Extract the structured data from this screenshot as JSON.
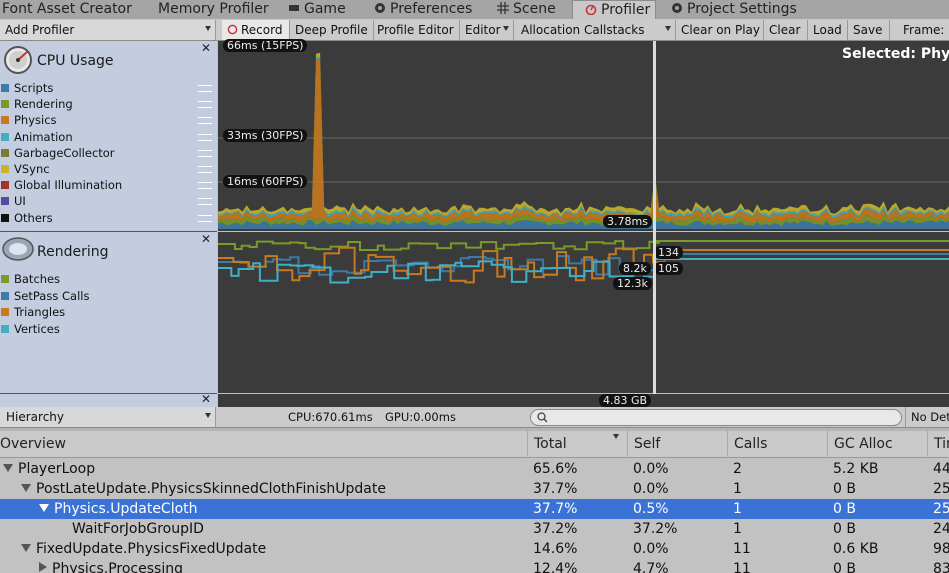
{
  "tabs": [
    {
      "label": "Font Asset Creator",
      "icon": ""
    },
    {
      "label": "Memory Profiler",
      "icon": ""
    },
    {
      "label": "Game",
      "icon": "game-icon"
    },
    {
      "label": "Preferences",
      "icon": "gear-icon"
    },
    {
      "label": "Scene",
      "icon": "grid-icon"
    },
    {
      "label": "Profiler",
      "icon": "profiler-icon"
    },
    {
      "label": "Project Settings",
      "icon": "gear-icon"
    }
  ],
  "toolbar": {
    "add_profiler": "Add Profiler",
    "record": "Record",
    "deep_profile": "Deep Profile",
    "profile_editor": "Profile Editor",
    "editor": "Editor",
    "allocation_callstacks": "Allocation Callstacks",
    "clear_on_play": "Clear on Play",
    "clear": "Clear",
    "load": "Load",
    "save": "Save",
    "frame": "Frame:"
  },
  "cpu": {
    "title": "CPU Usage",
    "legend": [
      {
        "label": "Scripts",
        "color": "#3d7aa6"
      },
      {
        "label": "Rendering",
        "color": "#7b9a2a"
      },
      {
        "label": "Physics",
        "color": "#c77a1e"
      },
      {
        "label": "Animation",
        "color": "#3fb0c8"
      },
      {
        "label": "GarbageCollector",
        "color": "#7a7a3a"
      },
      {
        "label": "VSync",
        "color": "#c9b52b"
      },
      {
        "label": "Global Illumination",
        "color": "#a0332b"
      },
      {
        "label": "UI",
        "color": "#5a4a9a"
      },
      {
        "label": "Others",
        "color": "#111111"
      }
    ],
    "labels": {
      "l66": "66ms (15FPS)",
      "l33": "33ms (30FPS)",
      "l16": "16ms (60FPS)",
      "current": "3.78ms"
    },
    "selected": "Selected: Phys"
  },
  "rendering": {
    "title": "Rendering",
    "legend": [
      {
        "label": "Batches",
        "color": "#7b9a2a"
      },
      {
        "label": "SetPass Calls",
        "color": "#3d7aa6"
      },
      {
        "label": "Triangles",
        "color": "#c77a1e"
      },
      {
        "label": "Vertices",
        "color": "#3fb0c8"
      }
    ],
    "values": {
      "batches": "134",
      "setpass": "105",
      "triangles": "8.2k",
      "vertices": "12.3k"
    }
  },
  "memory": {
    "value": "4.83 GB"
  },
  "hierarchy": {
    "mode": "Hierarchy",
    "cpu": "CPU:670.61ms",
    "gpu": "GPU:0.00ms",
    "search_placeholder": "",
    "no_details": "No Det"
  },
  "table": {
    "headers": [
      "Overview",
      "Total",
      "Self",
      "Calls",
      "GC Alloc",
      "Tim"
    ],
    "rows": [
      {
        "name": "PlayerLoop",
        "total": "65.6%",
        "self": "0.0%",
        "calls": "2",
        "gc": "5.2 KB",
        "time": "44",
        "indent": 0,
        "expand": "down",
        "selected": false
      },
      {
        "name": "PostLateUpdate.PhysicsSkinnedClothFinishUpdate",
        "total": "37.7%",
        "self": "0.0%",
        "calls": "1",
        "gc": "0 B",
        "time": "25",
        "indent": 1,
        "expand": "down",
        "selected": false
      },
      {
        "name": "Physics.UpdateCloth",
        "total": "37.7%",
        "self": "0.5%",
        "calls": "1",
        "gc": "0 B",
        "time": "25",
        "indent": 2,
        "expand": "down",
        "selected": true
      },
      {
        "name": "WaitForJobGroupID",
        "total": "37.2%",
        "self": "37.2%",
        "calls": "1",
        "gc": "0 B",
        "time": "24",
        "indent": 3,
        "expand": "none",
        "selected": false
      },
      {
        "name": "FixedUpdate.PhysicsFixedUpdate",
        "total": "14.6%",
        "self": "0.0%",
        "calls": "11",
        "gc": "0.6 KB",
        "time": "98",
        "indent": 1,
        "expand": "down",
        "selected": false
      },
      {
        "name": "Physics.Processing",
        "total": "12.4%",
        "self": "4.7%",
        "calls": "11",
        "gc": "0 B",
        "time": "83",
        "indent": 2,
        "expand": "right",
        "selected": false
      }
    ]
  }
}
